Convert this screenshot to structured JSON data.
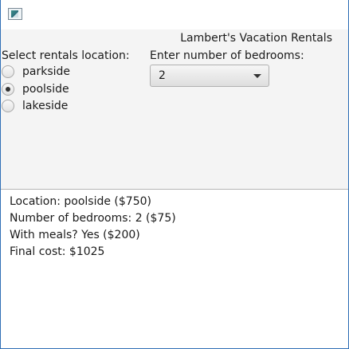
{
  "window": {
    "icon": "java-app-icon"
  },
  "header": {
    "title": "Lambert's Vacation Rentals"
  },
  "location": {
    "label": "Select rentals location:",
    "options": [
      {
        "label": "parkside",
        "selected": false
      },
      {
        "label": "poolside",
        "selected": true
      },
      {
        "label": "lakeside",
        "selected": false
      }
    ]
  },
  "bedrooms": {
    "label": "Enter number of bedrooms:",
    "selected_value": "2"
  },
  "output": {
    "lines": [
      "Location: poolside ($750)",
      "Number of bedrooms: 2 ($75)",
      "With meals? Yes ($200)",
      "Final cost: $1025"
    ]
  }
}
